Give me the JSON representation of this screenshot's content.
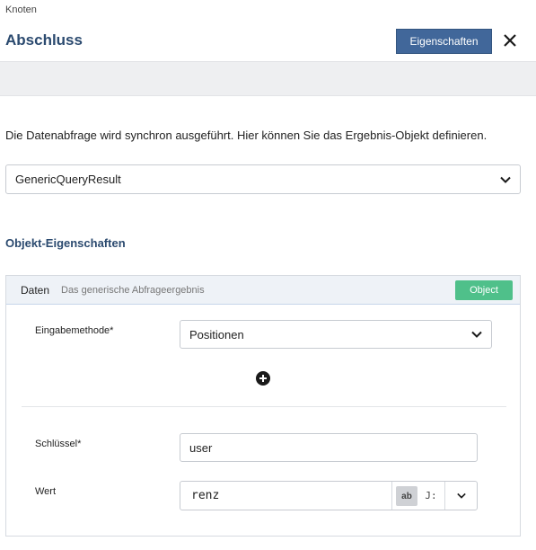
{
  "header": {
    "breadcrumb": "Knoten",
    "title": "Abschluss",
    "properties_button": "Eigenschaften"
  },
  "description": "Die Datenabfrage wird synchron ausgeführt. Hier können Sie das Ergebnis-Objekt definieren.",
  "result_select": {
    "value": "GenericQueryResult"
  },
  "section_heading": "Objekt-Eigenschaften",
  "panel": {
    "name": "Daten",
    "description": "Das generische Abfrageergebnis",
    "badge": "Object",
    "input_method": {
      "label": "Eingabemethode*",
      "value": "Positionen"
    },
    "key": {
      "label": "Schlüssel*",
      "value": "user"
    },
    "value": {
      "label": "Wert",
      "value": "renz",
      "type_ab": "ab",
      "type_js": "J:"
    }
  },
  "colors": {
    "accent": "#41679a",
    "heading": "#2b4a6f",
    "badge": "#4fc08a"
  },
  "icons": {
    "close": "close-icon",
    "chevron": "chevron-down-icon",
    "add": "plus-circle-icon"
  }
}
